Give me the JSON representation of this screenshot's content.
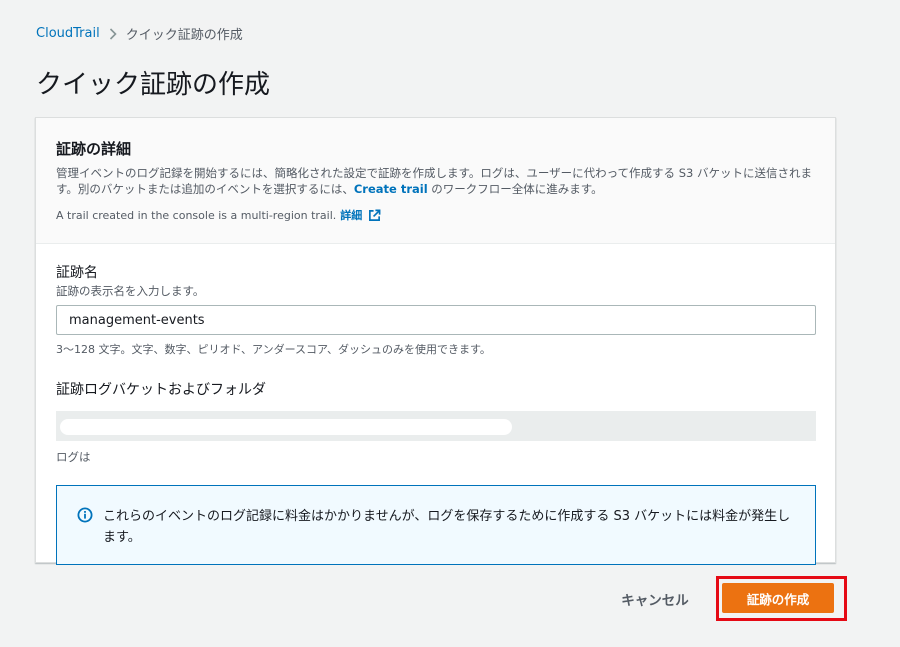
{
  "breadcrumb": {
    "root": "CloudTrail",
    "current": "クイック証跡の作成"
  },
  "page": {
    "title": "クイック証跡の作成"
  },
  "panel": {
    "title": "証跡の詳細",
    "desc_before_link": "管理イベントのログ記録を開始するには、簡略化された設定で証跡を作成します。ログは、ユーザーに代わって作成する S3 バケットに送信されます。別のバケットまたは追加のイベントを選択するには、",
    "desc_link": "Create trail",
    "desc_after_link": " のワークフロー全体に進みます。",
    "note_text": "A trail created in the console is a multi-region trail.",
    "note_link": "詳細"
  },
  "trail_name": {
    "label": "証跡名",
    "description": "証跡の表示名を入力します。",
    "value": "management-events",
    "constraint": "3～128 文字。文字、数字、ピリオド、アンダースコア、ダッシュのみを使用できます。"
  },
  "bucket": {
    "label": "証跡ログバケットおよびフォルダ",
    "caption": "ログは"
  },
  "info": {
    "text": "これらのイベントのログ記録に料金はかかりませんが、ログを保存するために作成する S3 バケットには料金が発生します。"
  },
  "actions": {
    "cancel": "キャンセル",
    "create": "証跡の作成"
  },
  "colors": {
    "link": "#0073bb",
    "primary": "#ec7211",
    "highlight": "#e50914",
    "info_border": "#0073bb"
  },
  "icons": {
    "breadcrumb_separator": "chevron-right-icon",
    "external_link": "external-link-icon",
    "info": "info-icon"
  }
}
